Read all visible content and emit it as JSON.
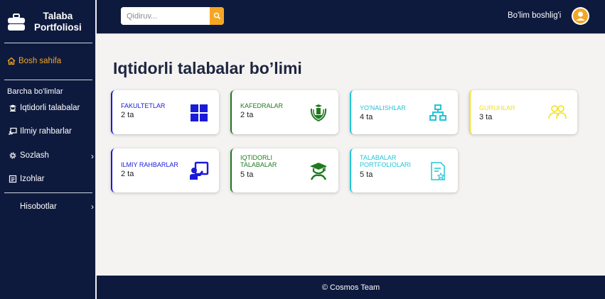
{
  "app": {
    "brand_line1": "Talaba",
    "brand_line2": "Portfoliosi"
  },
  "sidebar": {
    "home_label": "Bosh sahifa",
    "section_label": "Barcha bo'limlar",
    "items": [
      {
        "label": "Iqtidorli talabalar",
        "icon": "graduate-icon"
      },
      {
        "label": "Ilmiy rahbarlar",
        "icon": "presentation-icon"
      },
      {
        "label": "Sozlash",
        "icon": "gear-icon"
      },
      {
        "label": "Izohlar",
        "icon": "notes-icon"
      }
    ],
    "reports_label": "Hisobotlar"
  },
  "header": {
    "search_placeholder": "Qidiruv...",
    "user_role": "Bo'lim boshlig'i"
  },
  "main": {
    "title": "Iqtidorli talabalar bo’limi",
    "cards": [
      {
        "label": "FAKULTETLAR",
        "count": "2 ta",
        "color": "#1a1adb",
        "icon": "grid-icon"
      },
      {
        "label": "KAFEDRALAR",
        "count": "2 ta",
        "color": "#1f7a1f",
        "icon": "emblem-icon"
      },
      {
        "label": "YO'NALISHLAR",
        "count": "4 ta",
        "color": "#22c5d6",
        "icon": "network-icon"
      },
      {
        "label": "GURUHLAR",
        "count": "3 ta",
        "color": "#f2e21b",
        "icon": "group-icon"
      },
      {
        "label": "ILMIY RAHBARLAR",
        "count": "2 ta",
        "color": "#1a1adb",
        "icon": "teacher-icon"
      },
      {
        "label": "IQTIDORLI TALABALAR",
        "count": "5 ta",
        "color": "#1f7a1f",
        "icon": "student-icon"
      },
      {
        "label": "TALABALAR PORTFOLIOLARI",
        "count": "5 ta",
        "color": "#22c5d6",
        "icon": "portfolio-icon"
      }
    ]
  },
  "footer": {
    "text": "© Cosmos Team"
  },
  "colors": {
    "navy": "#0e1a3d",
    "accent": "#f5a623",
    "background": "#f4f3f1"
  }
}
